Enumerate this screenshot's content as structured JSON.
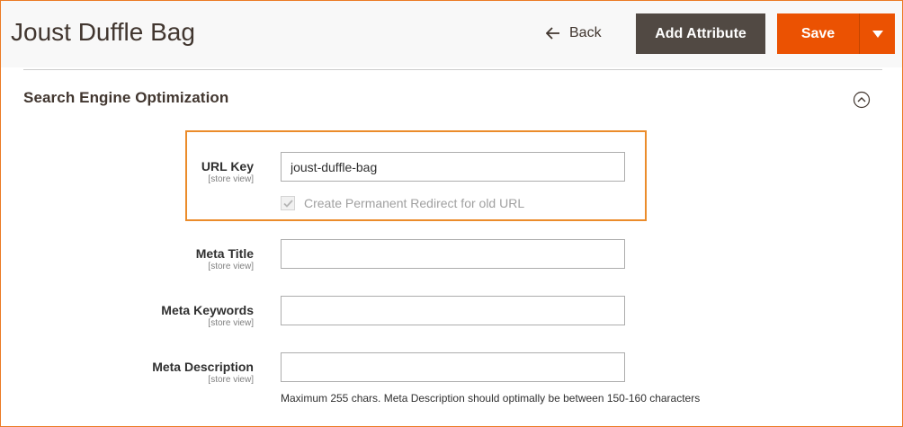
{
  "header": {
    "title": "Joust Duffle Bag",
    "back_label": "Back",
    "add_attribute_label": "Add Attribute",
    "save_label": "Save"
  },
  "section": {
    "title": "Search Engine Optimization"
  },
  "fields": {
    "url_key": {
      "label": "URL Key",
      "scope": "[store view]",
      "value": "joust-duffle-bag",
      "redirect_label": "Create Permanent Redirect for old URL",
      "redirect_checked": true,
      "redirect_disabled": true
    },
    "meta_title": {
      "label": "Meta Title",
      "scope": "[store view]",
      "value": ""
    },
    "meta_keywords": {
      "label": "Meta Keywords",
      "scope": "[store view]",
      "value": ""
    },
    "meta_description": {
      "label": "Meta Description",
      "scope": "[store view]",
      "value": "",
      "note": "Maximum 255 chars. Meta Description should optimally be between 150-160 characters"
    }
  },
  "colors": {
    "accent": "#eb5202",
    "dark_button": "#514943",
    "highlight": "#eb8c2b"
  }
}
